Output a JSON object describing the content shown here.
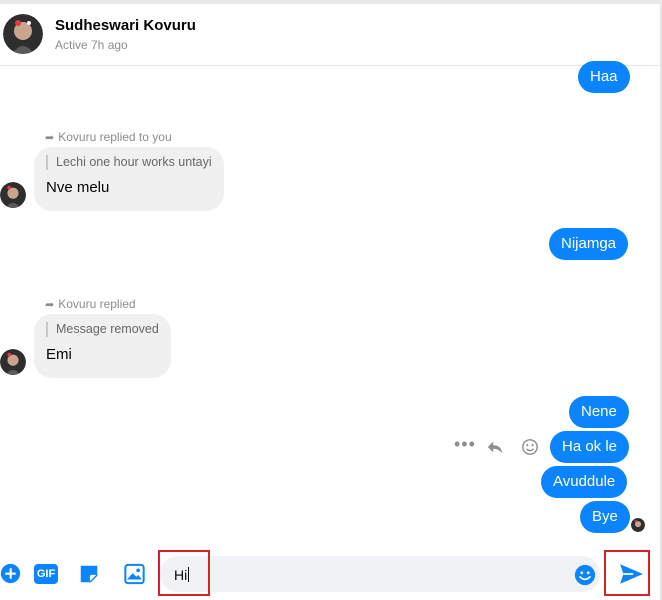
{
  "header": {
    "name": "Sudheswari Kovuru",
    "status": "Active 7h ago"
  },
  "messages": {
    "out_haa": "Haa",
    "reply1": {
      "note": "Kovuru replied to you",
      "quote": "Lechi one hour works untayi",
      "text": "Nve melu"
    },
    "out_nijamga": "Nijamga",
    "reply2": {
      "note": "Kovuru replied",
      "quote": "Message removed",
      "text": "Emi"
    },
    "out_nene": "Nene",
    "out_ha_ok_le": "Ha ok le",
    "out_avuddule": "Avuddule",
    "out_bye": "Bye"
  },
  "composer": {
    "input_value": "Hi",
    "gif_label": "GIF"
  },
  "icons": {
    "add": "plus-circle-icon",
    "gif": "gif-icon",
    "sticker": "sticker-icon",
    "photo": "image-icon",
    "emoji": "emoji-icon",
    "send": "send-icon",
    "more": "more-icon",
    "reply": "reply-icon",
    "react": "react-icon"
  },
  "colors": {
    "accent": "#0a84ff",
    "incoming_bg": "#f0f0f0",
    "highlight": "#d6232a"
  }
}
